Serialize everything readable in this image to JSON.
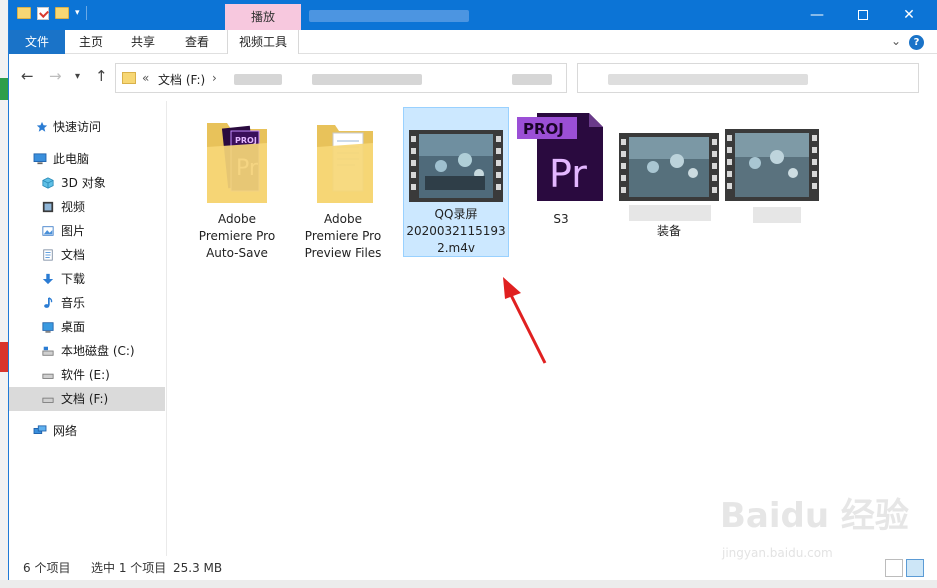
{
  "title_bar": {
    "context_tab": "播放"
  },
  "ribbon": {
    "file_tab": "文件",
    "tabs": [
      "主页",
      "共享",
      "查看",
      "视频工具"
    ]
  },
  "address": {
    "prefix": "«",
    "crumb": "文档 (F:)",
    "separator": "›"
  },
  "sidebar": {
    "items": [
      {
        "label": "快速访问",
        "icon": "star-icon"
      },
      {
        "label": "此电脑",
        "icon": "computer-icon"
      },
      {
        "label": "3D 对象",
        "icon": "cube-icon"
      },
      {
        "label": "视频",
        "icon": "video-folder-icon"
      },
      {
        "label": "图片",
        "icon": "pictures-icon"
      },
      {
        "label": "文档",
        "icon": "documents-icon"
      },
      {
        "label": "下载",
        "icon": "download-icon"
      },
      {
        "label": "音乐",
        "icon": "music-icon"
      },
      {
        "label": "桌面",
        "icon": "desktop-icon"
      },
      {
        "label": "本地磁盘 (C:)",
        "icon": "drive-icon"
      },
      {
        "label": "软件 (E:)",
        "icon": "drive-icon"
      },
      {
        "label": "文档 (F:)",
        "icon": "drive-icon",
        "selected": true
      },
      {
        "label": "网络",
        "icon": "network-icon"
      }
    ]
  },
  "files": [
    {
      "name": "Adobe Premiere Pro Auto-Save",
      "lines": [
        "Adobe",
        "Premiere Pro",
        "Auto-Save"
      ],
      "type": "folder"
    },
    {
      "name": "Adobe Premiere Pro Preview Files",
      "lines": [
        "Adobe",
        "Premiere Pro",
        "Preview Files"
      ],
      "type": "folder"
    },
    {
      "name": "QQ录屏20200321151932.m4v",
      "lines": [
        "QQ录屏",
        "2020032115193",
        "2.m4v"
      ],
      "type": "video",
      "selected": true
    },
    {
      "name": "S3",
      "lines": [
        "S3"
      ],
      "type": "premiere-project"
    },
    {
      "name": "装备",
      "lines": [
        "装备"
      ],
      "type": "video"
    },
    {
      "name": "",
      "lines": [
        ""
      ],
      "type": "video"
    }
  ],
  "status": {
    "count": "6 个项目",
    "selected": "选中 1 个项目",
    "size": "25.3 MB"
  },
  "watermark": {
    "brand": "Baidu 经验",
    "url": "jingyan.baidu.com"
  },
  "colors": {
    "titlebar": "#0c74d6",
    "selection": "#cce8ff",
    "arrow": "#e02020",
    "premiere": "#2a0a3f"
  }
}
